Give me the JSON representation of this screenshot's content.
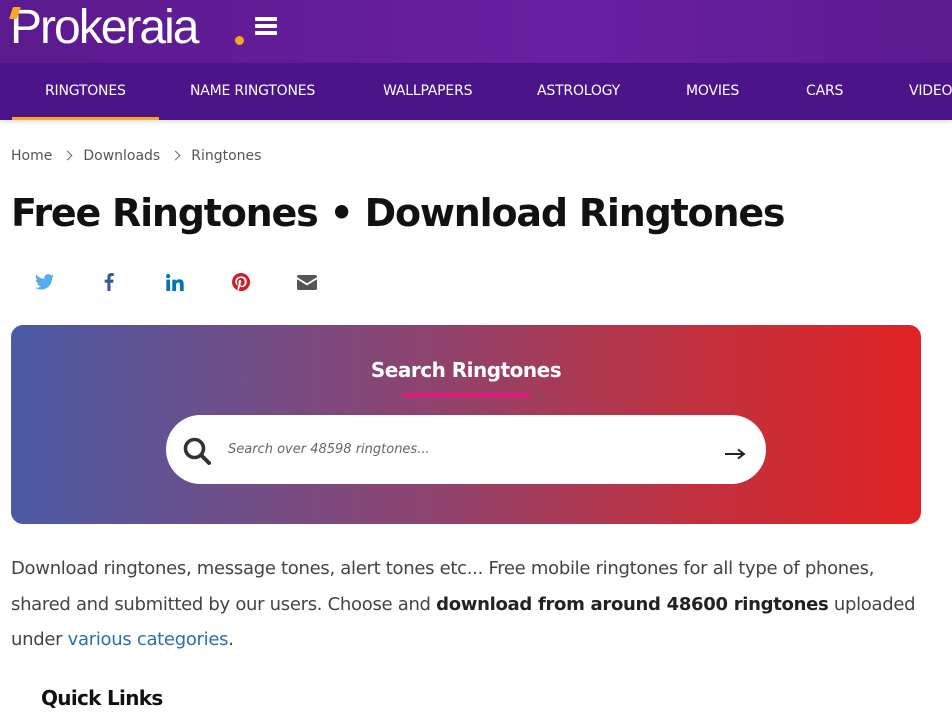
{
  "header": {
    "logo_text": "Prokeraia",
    "menu_icon": "hamburger-menu-icon",
    "background_color": "#6a1fa0"
  },
  "nav": {
    "items": [
      {
        "label": "RINGTONES",
        "active": true
      },
      {
        "label": "NAME RINGTONES",
        "active": false
      },
      {
        "label": "WALLPAPERS",
        "active": false
      },
      {
        "label": "ASTROLOGY",
        "active": false
      },
      {
        "label": "MOVIES",
        "active": false
      },
      {
        "label": "CARS",
        "active": false
      },
      {
        "label": "VIDEO",
        "active": false
      }
    ],
    "background_color": "#4b1489",
    "active_indicator_color": "#f6a623"
  },
  "breadcrumb": {
    "items": [
      "Home",
      "Downloads",
      "Ringtones"
    ]
  },
  "page": {
    "title": "Free Ringtones • Download Ringtones"
  },
  "share": {
    "icons": [
      {
        "name": "twitter-icon",
        "color": "#55acee"
      },
      {
        "name": "facebook-icon",
        "color": "#3b5998"
      },
      {
        "name": "linkedin-icon",
        "color": "#0077b5"
      },
      {
        "name": "pinterest-icon",
        "color": "#cb2027"
      },
      {
        "name": "email-icon",
        "color": "#555555"
      }
    ]
  },
  "search": {
    "title": "Search Ringtones",
    "placeholder": "Search over 48598 ringtones...",
    "value": "",
    "submit_icon": "arrow-right-icon",
    "gradient_start": "#4b5aa5",
    "gradient_end": "#e02324",
    "underline_color": "#e2187a"
  },
  "intro": {
    "text_1": "Download ringtones, message tones, alert tones etc... Free mobile ringtones for all type of phones, shared and submitted by our users. Choose and ",
    "bold": "download from around 48600 ringtones",
    "text_2": " uploaded under ",
    "link": "various categories",
    "text_3": "."
  },
  "quick_links": {
    "heading": "Quick Links"
  }
}
